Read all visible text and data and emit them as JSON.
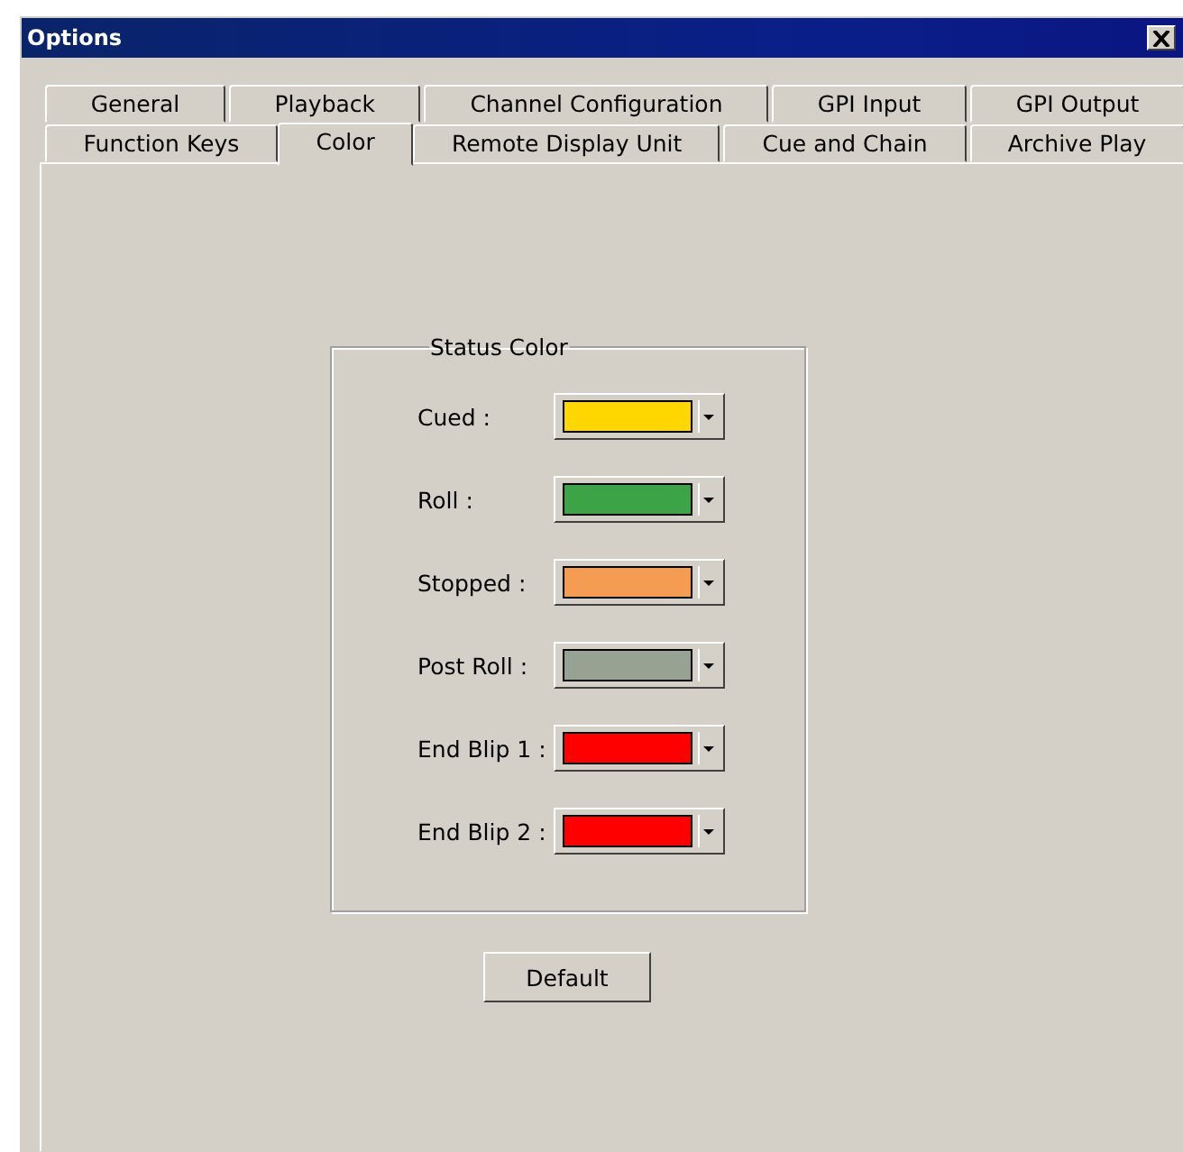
{
  "window": {
    "title": "Options"
  },
  "tab_rows": [
    {
      "tabs": [
        {
          "label": "General",
          "selected": false
        },
        {
          "label": "Playback",
          "selected": false
        },
        {
          "label": "Channel Configuration",
          "selected": false
        },
        {
          "label": "GPI Input",
          "selected": false
        },
        {
          "label": "GPI Output",
          "selected": false
        }
      ]
    },
    {
      "tabs": [
        {
          "label": "Function Keys",
          "selected": false
        },
        {
          "label": "Color",
          "selected": true
        },
        {
          "label": "Remote Display Unit",
          "selected": false
        },
        {
          "label": "Cue and Chain",
          "selected": false
        },
        {
          "label": "Archive Play",
          "selected": false
        }
      ]
    }
  ],
  "status_color": {
    "title": "Status Color",
    "rows": [
      {
        "label": "Cued :",
        "color": "#ffd700"
      },
      {
        "label": "Roll :",
        "color": "#3ca346"
      },
      {
        "label": "Stopped :",
        "color": "#f39c52"
      },
      {
        "label": "Post Roll :",
        "color": "#98a292"
      },
      {
        "label": "End Blip 1 :",
        "color": "#ff0000"
      },
      {
        "label": "End Blip 2 :",
        "color": "#ff0000"
      }
    ]
  },
  "buttons": [
    {
      "label": "Default"
    }
  ]
}
